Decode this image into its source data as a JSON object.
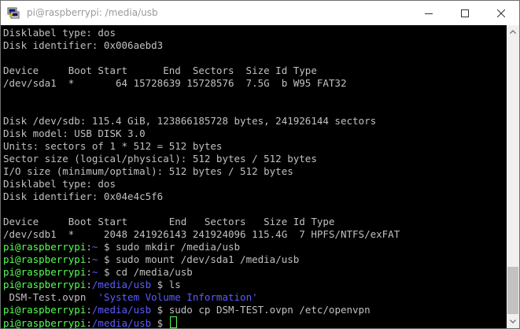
{
  "window": {
    "title": "pi@raspberrypi: /media/usb"
  },
  "terminal": {
    "lines": [
      {
        "text": "Disklabel type: dos"
      },
      {
        "text": "Disk identifier: 0x006aebd3"
      },
      {
        "text": ""
      },
      {
        "text": "Device     Boot Start      End  Sectors  Size Id Type"
      },
      {
        "text": "/dev/sda1  *       64 15728639 15728576  7.5G  b W95 FAT32"
      },
      {
        "text": ""
      },
      {
        "text": ""
      },
      {
        "text": "Disk /dev/sdb: 115.4 GiB, 123866185728 bytes, 241926144 sectors"
      },
      {
        "text": "Disk model: USB DISK 3.0"
      },
      {
        "text": "Units: sectors of 1 * 512 = 512 bytes"
      },
      {
        "text": "Sector size (logical/physical): 512 bytes / 512 bytes"
      },
      {
        "text": "I/O size (minimum/optimal): 512 bytes / 512 bytes"
      },
      {
        "text": "Disklabel type: dos"
      },
      {
        "text": "Disk identifier: 0x04e4c5f6"
      },
      {
        "text": ""
      },
      {
        "text": "Device     Boot Start       End   Sectors   Size Id Type"
      },
      {
        "text": "/dev/sdb1  *     2048 241926143 241924096 115.4G  7 HPFS/NTFS/exFAT"
      },
      {
        "user": "pi@raspberrypi",
        "sep": ":",
        "path": "~",
        "dollar": " $ ",
        "cmd": "sudo mkdir /media/usb"
      },
      {
        "user": "pi@raspberrypi",
        "sep": ":",
        "path": "~",
        "dollar": " $ ",
        "cmd": "sudo mount /dev/sda1 /media/usb"
      },
      {
        "user": "pi@raspberrypi",
        "sep": ":",
        "path": "~",
        "dollar": " $ ",
        "cmd": "cd /media/usb"
      },
      {
        "user": "pi@raspberrypi",
        "sep": ":",
        "path": "/media/usb",
        "dollar": " $ ",
        "cmd": "ls"
      },
      {
        "plain": " DSM-Test.ovpn  ",
        "quoted": "'System Volume Information'"
      },
      {
        "user": "pi@raspberrypi",
        "sep": ":",
        "path": "/media/usb",
        "dollar": " $ ",
        "cmd": "sudo cp DSM-TEST.ovpn /etc/openvpn"
      },
      {
        "user": "pi@raspberrypi",
        "sep": ":",
        "path": "/media/usb",
        "dollar": " $ ",
        "cmd": "",
        "cursor": true
      }
    ]
  },
  "colors": {
    "terminal_bg": "#000000",
    "text": "#c0c0c0",
    "prompt_user": "#55ff55",
    "prompt_path": "#5c5cff"
  },
  "icons": {
    "app": "putty-icon",
    "minimize": "minimize-icon",
    "maximize": "maximize-icon",
    "close": "close-icon"
  }
}
